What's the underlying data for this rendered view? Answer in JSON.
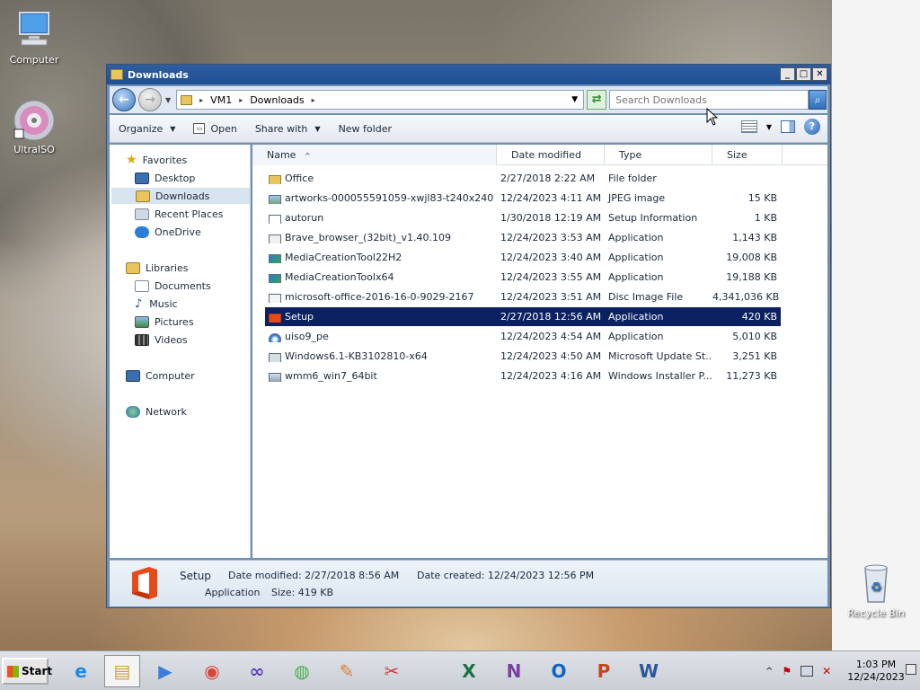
{
  "desktop": {
    "icons": [
      {
        "label": "Computer"
      },
      {
        "label": "UltraISO"
      },
      {
        "label": "Recycle Bin"
      }
    ]
  },
  "window": {
    "title": "Downloads",
    "controls": {
      "minimize": "_",
      "maximize": "□",
      "close": "✕"
    }
  },
  "address": {
    "crumbs": [
      "VM1",
      "Downloads"
    ],
    "search_placeholder": "Search Downloads"
  },
  "commands": {
    "organize": "Organize",
    "open": "Open",
    "share_with": "Share with",
    "new_folder": "New folder"
  },
  "nav": {
    "favorites": "Favorites",
    "desktop": "Desktop",
    "downloads": "Downloads",
    "recent_places": "Recent Places",
    "onedrive": "OneDrive",
    "libraries": "Libraries",
    "documents": "Documents",
    "music": "Music",
    "pictures": "Pictures",
    "videos": "Videos",
    "computer": "Computer",
    "network": "Network"
  },
  "columns": {
    "name": "Name",
    "date": "Date modified",
    "type": "Type",
    "size": "Size"
  },
  "files": [
    {
      "name": "Office",
      "date": "2/27/2018 2:22 AM",
      "type": "File folder",
      "size": "",
      "icon": "folder-icon"
    },
    {
      "name": "artworks-000055591059-xwjl83-t240x240",
      "date": "12/24/2023 4:11 AM",
      "type": "JPEG image",
      "size": "15 KB",
      "icon": "image-file-icon"
    },
    {
      "name": "autorun",
      "date": "1/30/2018 12:19 AM",
      "type": "Setup Information",
      "size": "1 KB",
      "icon": "setup-info-icon"
    },
    {
      "name": "Brave_browser_(32bit)_v1.40.109",
      "date": "12/24/2023 3:53 AM",
      "type": "Application",
      "size": "1,143 KB",
      "icon": "app-icon"
    },
    {
      "name": "MediaCreationTool22H2",
      "date": "12/24/2023 3:40 AM",
      "type": "Application",
      "size": "19,008 KB",
      "icon": "media-creation-icon"
    },
    {
      "name": "MediaCreationToolx64",
      "date": "12/24/2023 3:55 AM",
      "type": "Application",
      "size": "19,188 KB",
      "icon": "media-creation-icon"
    },
    {
      "name": "microsoft-office-2016-16-0-9029-2167",
      "date": "12/24/2023 3:51 AM",
      "type": "Disc Image File",
      "size": "4,341,036 KB",
      "icon": "disc-image-icon"
    },
    {
      "name": "Setup",
      "date": "2/27/2018 12:56 AM",
      "type": "Application",
      "size": "420 KB",
      "icon": "office-setup-icon"
    },
    {
      "name": "uiso9_pe",
      "date": "12/24/2023 4:54 AM",
      "type": "Application",
      "size": "5,010 KB",
      "icon": "ultraiso-setup-icon"
    },
    {
      "name": "Windows6.1-KB3102810-x64",
      "date": "12/24/2023 4:50 AM",
      "type": "Microsoft Update St...",
      "size": "3,251 KB",
      "icon": "update-package-icon"
    },
    {
      "name": "wmm6_win7_64bit",
      "date": "12/24/2023 4:16 AM",
      "type": "Windows Installer P...",
      "size": "11,273 KB",
      "icon": "installer-package-icon"
    }
  ],
  "details": {
    "name": "Setup",
    "type": "Application",
    "modified_label": "Date modified:",
    "modified": "2/27/2018 8:56 AM",
    "size_label": "Size:",
    "size": "419 KB",
    "created_label": "Date created:",
    "created": "12/24/2023 12:56 PM"
  },
  "taskbar": {
    "start": "Start",
    "time": "1:03 PM",
    "date": "12/24/2023",
    "apps": [
      "internet-explorer-icon",
      "explorer-icon",
      "media-center-icon",
      "chrome-icon",
      "infinity-icon",
      "windows-live-icon",
      "paint-icon",
      "snipping-tool-icon",
      "excel-icon",
      "onenote-icon",
      "outlook-icon",
      "powerpoint-icon",
      "word-icon"
    ]
  }
}
